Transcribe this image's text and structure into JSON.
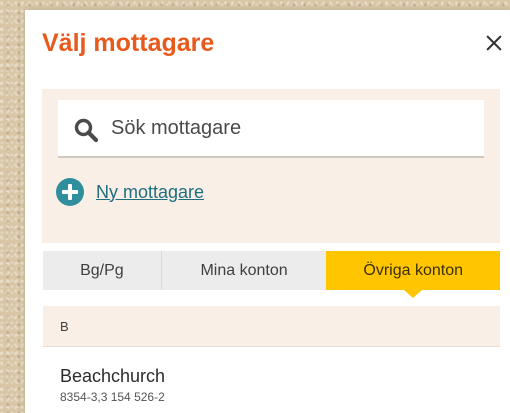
{
  "modal": {
    "title": "Välj mottagare",
    "close_icon": "close-icon"
  },
  "search": {
    "placeholder": "Sök mottagare",
    "value": "",
    "icon": "search-icon"
  },
  "new_recipient": {
    "label": "Ny mottagare",
    "icon": "plus-circle-icon",
    "icon_color": "#2f8f9d"
  },
  "tabs": [
    {
      "label": "Bg/Pg",
      "active": false
    },
    {
      "label": "Mina konton",
      "active": false
    },
    {
      "label": "Övriga konton",
      "active": true
    }
  ],
  "colors": {
    "title": "#e8591c",
    "active_tab": "#ffc600",
    "panel": "#faefe6",
    "link": "#1e6f80"
  },
  "recipients": {
    "groups": [
      {
        "letter": "B",
        "items": [
          {
            "name": "Beachchurch",
            "account": "8354-3,3 154 526-2"
          }
        ]
      }
    ]
  }
}
